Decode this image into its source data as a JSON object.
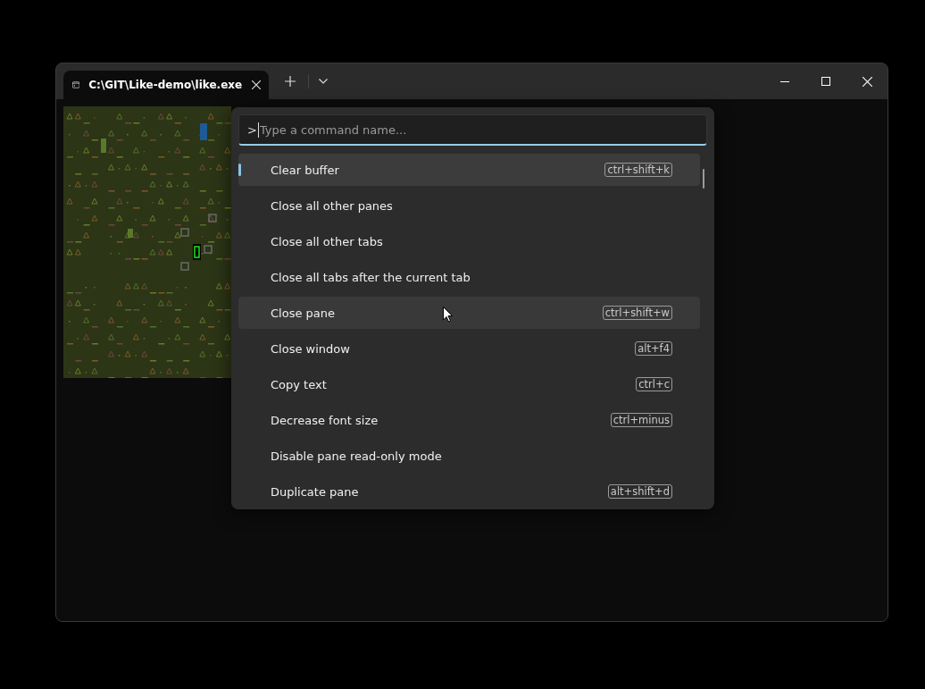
{
  "window": {
    "tab": {
      "title": "C:\\GIT\\Like-demo\\like.exe",
      "selected": true
    }
  },
  "command_palette": {
    "prefix": ">",
    "placeholder": "Type a command name...",
    "items": [
      {
        "label": "Clear buffer",
        "shortcut": "ctrl+shift+k",
        "selected": true,
        "hovered": false
      },
      {
        "label": "Close all other panes",
        "selected": false,
        "hovered": false
      },
      {
        "label": "Close all other tabs",
        "selected": false,
        "hovered": false
      },
      {
        "label": "Close all tabs after the current tab",
        "selected": false,
        "hovered": false
      },
      {
        "label": "Close pane",
        "shortcut": "ctrl+shift+w",
        "selected": false,
        "hovered": true
      },
      {
        "label": "Close window",
        "shortcut": "alt+f4",
        "selected": false,
        "hovered": false
      },
      {
        "label": "Copy text",
        "shortcut": "ctrl+c",
        "selected": false,
        "hovered": false
      },
      {
        "label": "Decrease font size",
        "shortcut": "ctrl+minus",
        "selected": false,
        "hovered": false
      },
      {
        "label": "Disable pane read-only mode",
        "selected": false,
        "hovered": false
      },
      {
        "label": "Duplicate pane",
        "shortcut": "alt+shift+d",
        "selected": false,
        "hovered": false
      }
    ]
  }
}
